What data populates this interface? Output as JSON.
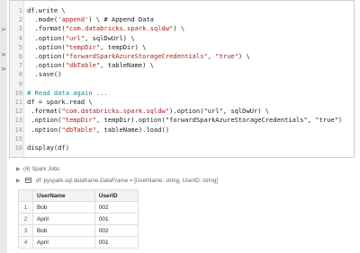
{
  "notebook": {
    "code_lines": [
      {
        "n": "1",
        "src": "df.write \\",
        "c": "",
        "s": "",
        "t": ""
      },
      {
        "n": "2",
        "src": "  .mode(",
        "c": "",
        "s": "'append'",
        "t": ") \\ # Append Data"
      },
      {
        "n": "3",
        "src": "  .format(",
        "c": "",
        "s": "\"com.databricks.spark.sqldw\"",
        "t": ") \\"
      },
      {
        "n": "4",
        "src": "  .option(",
        "c": "",
        "s": "\"url\"",
        "t": ", sqlDwUrl) \\"
      },
      {
        "n": "5",
        "src": "  .option(",
        "c": "",
        "s": "\"tempDir\"",
        "t": ", tempDir) \\"
      },
      {
        "n": "6",
        "src": "  .option(",
        "c": "",
        "s": "\"forwardSparkAzureStorageCredentials\", \"true\"",
        "t": ") \\"
      },
      {
        "n": "7",
        "src": "  .option(",
        "c": "",
        "s": "\"dbTable\"",
        "t": ", tableName) \\"
      },
      {
        "n": "8",
        "src": "  .save()",
        "c": "",
        "s": "",
        "t": ""
      },
      {
        "n": "9",
        "src": "",
        "c": "",
        "s": "",
        "t": ""
      },
      {
        "n": "10",
        "src": "",
        "c": "# Read data again ...",
        "s": "",
        "t": ""
      },
      {
        "n": "11",
        "src": "df = spark.read \\",
        "c": "",
        "s": "",
        "t": ""
      },
      {
        "n": "12",
        "src": " .format(",
        "c": "",
        "s": "\"com.databricks.spark.sqldw\"",
        "t": ").option(\"url\", sqlDwUr) \\"
      },
      {
        "n": "13",
        "src": " .option(",
        "c": "",
        "s": "\"tempDir\"",
        "t": ", tempDir).option(\"forwardSparkAzureStorageCredentials\", \"true\")"
      },
      {
        "n": "14",
        "src": " .option(",
        "c": "",
        "s": "\"dbTable\"",
        "t": ", tableName).load()"
      },
      {
        "n": "15",
        "src": "",
        "c": "",
        "s": "",
        "t": ""
      },
      {
        "n": "16",
        "src": "display(df)",
        "c": "",
        "s": "",
        "t": ""
      }
    ],
    "spark_jobs_label": "(4) Spark Jobs",
    "df_schema": "df:  pyspark.sql.dataframe.DataFrame = [UserName: string, UserID: string]",
    "strip_markers": [
      ">",
      ">",
      ">"
    ]
  },
  "result_table": {
    "headers": [
      "",
      "UserName",
      "UserID"
    ],
    "rows": [
      [
        "1",
        "Bob",
        "002"
      ],
      [
        "2",
        "April",
        "001"
      ],
      [
        "3",
        "Bob",
        "002"
      ],
      [
        "4",
        "April",
        "001"
      ]
    ]
  }
}
